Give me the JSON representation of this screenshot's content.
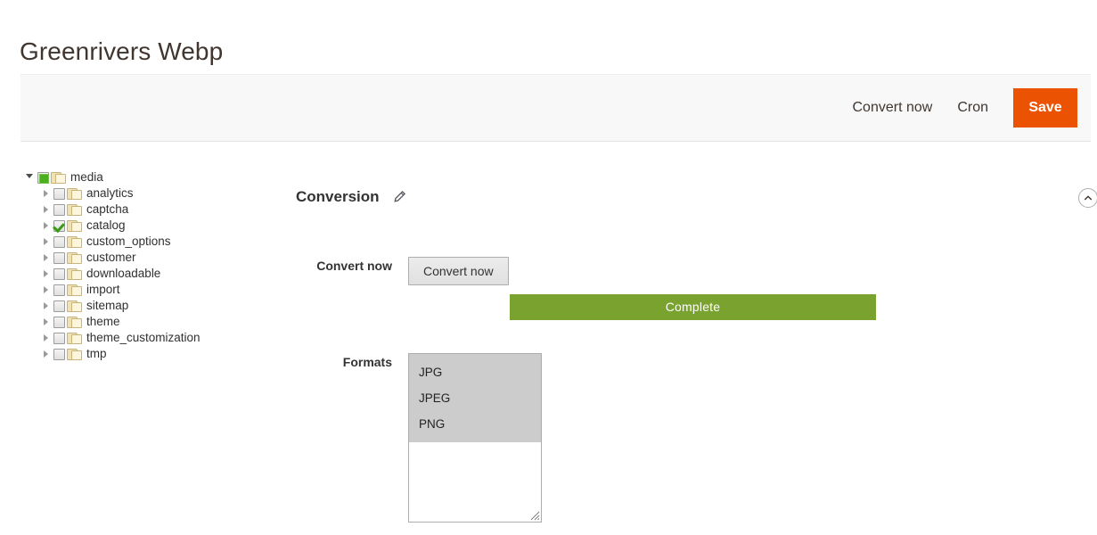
{
  "page": {
    "title": "Greenrivers Webp"
  },
  "toolbar": {
    "convert_now_label": "Convert now",
    "cron_label": "Cron",
    "save_label": "Save",
    "save_color": "#eb5202"
  },
  "tree": {
    "nodes": [
      {
        "label": "media",
        "level": 0,
        "state": "partial",
        "expanded": true,
        "twisty": "expanded"
      },
      {
        "label": "analytics",
        "level": 1,
        "state": "unchecked",
        "expanded": false,
        "twisty": "collapsed"
      },
      {
        "label": "captcha",
        "level": 1,
        "state": "unchecked",
        "expanded": false,
        "twisty": "collapsed"
      },
      {
        "label": "catalog",
        "level": 1,
        "state": "checked",
        "expanded": false,
        "twisty": "collapsed"
      },
      {
        "label": "custom_options",
        "level": 1,
        "state": "unchecked",
        "expanded": false,
        "twisty": "collapsed"
      },
      {
        "label": "customer",
        "level": 1,
        "state": "unchecked",
        "expanded": false,
        "twisty": "collapsed"
      },
      {
        "label": "downloadable",
        "level": 1,
        "state": "unchecked",
        "expanded": false,
        "twisty": "collapsed"
      },
      {
        "label": "import",
        "level": 1,
        "state": "unchecked",
        "expanded": false,
        "twisty": "collapsed"
      },
      {
        "label": "sitemap",
        "level": 1,
        "state": "unchecked",
        "expanded": false,
        "twisty": "collapsed"
      },
      {
        "label": "theme",
        "level": 1,
        "state": "unchecked",
        "expanded": false,
        "twisty": "collapsed"
      },
      {
        "label": "theme_customization",
        "level": 1,
        "state": "unchecked",
        "expanded": false,
        "twisty": "collapsed"
      },
      {
        "label": "tmp",
        "level": 1,
        "state": "unchecked",
        "expanded": false,
        "twisty": "collapsed"
      }
    ]
  },
  "section": {
    "title": "Conversion",
    "edit_icon": "pencil-icon",
    "collapse_icon": "chevron-up-icon"
  },
  "fields": {
    "convert": {
      "label": "Convert now",
      "button_label": "Convert now",
      "status_label": "Complete",
      "status_color": "#79a22e"
    },
    "formats": {
      "label": "Formats",
      "options": [
        "JPG",
        "JPEG",
        "PNG"
      ],
      "selected": [
        "JPG",
        "JPEG",
        "PNG"
      ],
      "selection_color": "#cccccc"
    }
  }
}
